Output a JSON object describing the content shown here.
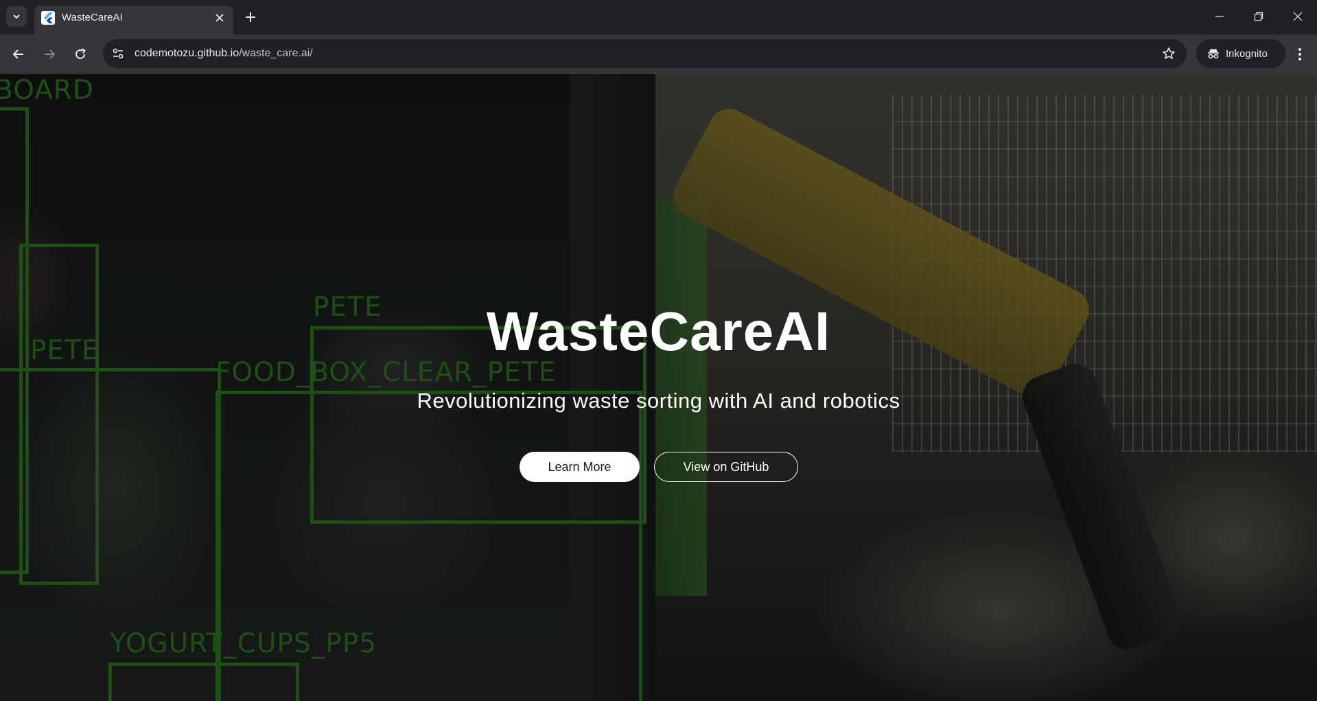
{
  "browser": {
    "tab": {
      "title": "WasteCareAI"
    },
    "url": {
      "host": "codemotozu.github.io",
      "path": "/waste_care.ai/"
    },
    "incognito_label": "Inkognito"
  },
  "detections": [
    {
      "label": "BOARD"
    },
    {
      "label": "PETE"
    },
    {
      "label": "PETE"
    },
    {
      "label": "FOOD_BOX_CLEAR_PETE"
    },
    {
      "label": "YOGURT_CUPS_PP5"
    }
  ],
  "hero": {
    "title": "WasteCareAI",
    "subtitle": "Revolutionizing waste sorting with AI and robotics",
    "learn_more": "Learn More",
    "github": "View on GitHub"
  },
  "colors": {
    "chrome_bg": "#202124",
    "toolbar_bg": "#35363a",
    "detection_green": "#2f7a1f",
    "hero_text": "#ffffff"
  }
}
